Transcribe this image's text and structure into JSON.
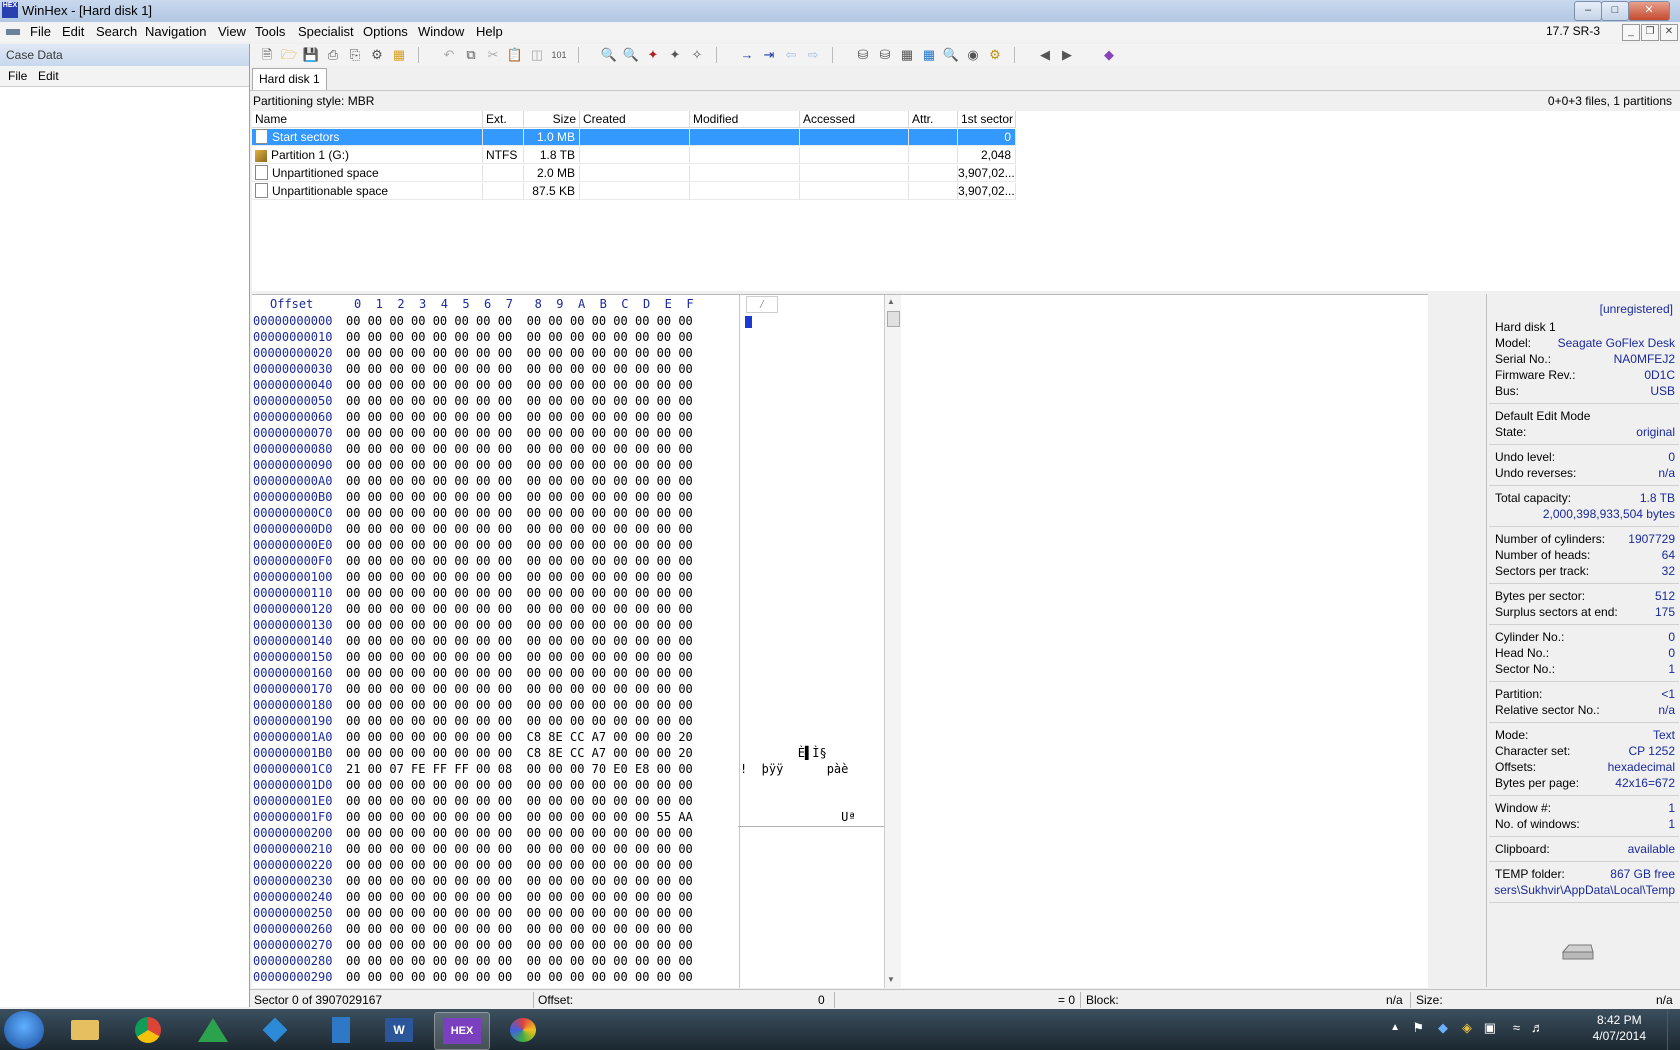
{
  "window": {
    "title": "WinHex - [Hard disk 1]",
    "version": "17.7 SR-3"
  },
  "menu": [
    "File",
    "Edit",
    "Search",
    "Navigation",
    "View",
    "Tools",
    "Specialist",
    "Options",
    "Window",
    "Help"
  ],
  "case": {
    "header": "Case Data",
    "menu": [
      "File",
      "Edit"
    ]
  },
  "tab": "Hard disk 1",
  "dir": {
    "partitioning": "Partitioning style: MBR",
    "summary": "0+0+3 files, 1 partitions",
    "columns": [
      "Name",
      "Ext.",
      "Size",
      "Created",
      "Modified",
      "Accessed",
      "Attr.",
      "1st sector"
    ],
    "rows": [
      {
        "name": "Start sectors",
        "ext": "",
        "size": "1.0 MB",
        "first": "0"
      },
      {
        "name": "Partition 1 (G:)",
        "ext": "NTFS",
        "size": "1.8 TB",
        "first": "2,048"
      },
      {
        "name": "Unpartitioned space",
        "ext": "",
        "size": "2.0 MB",
        "first": "3,907,02..."
      },
      {
        "name": "Unpartitionable space",
        "ext": "",
        "size": "87.5 KB",
        "first": "3,907,02..."
      }
    ]
  },
  "hex": {
    "header_offset": "Offset",
    "header_cols": "0  1  2  3  4  5  6  7   8  9  A  B  C  D  E  F",
    "rows": [
      {
        "o": "00000000000",
        "h": "00 00 00 00 00 00 00 00  00 00 00 00 00 00 00 00",
        "t": ""
      },
      {
        "o": "00000000010",
        "h": "00 00 00 00 00 00 00 00  00 00 00 00 00 00 00 00",
        "t": ""
      },
      {
        "o": "00000000020",
        "h": "00 00 00 00 00 00 00 00  00 00 00 00 00 00 00 00",
        "t": ""
      },
      {
        "o": "00000000030",
        "h": "00 00 00 00 00 00 00 00  00 00 00 00 00 00 00 00",
        "t": ""
      },
      {
        "o": "00000000040",
        "h": "00 00 00 00 00 00 00 00  00 00 00 00 00 00 00 00",
        "t": ""
      },
      {
        "o": "00000000050",
        "h": "00 00 00 00 00 00 00 00  00 00 00 00 00 00 00 00",
        "t": ""
      },
      {
        "o": "00000000060",
        "h": "00 00 00 00 00 00 00 00  00 00 00 00 00 00 00 00",
        "t": ""
      },
      {
        "o": "00000000070",
        "h": "00 00 00 00 00 00 00 00  00 00 00 00 00 00 00 00",
        "t": ""
      },
      {
        "o": "00000000080",
        "h": "00 00 00 00 00 00 00 00  00 00 00 00 00 00 00 00",
        "t": ""
      },
      {
        "o": "00000000090",
        "h": "00 00 00 00 00 00 00 00  00 00 00 00 00 00 00 00",
        "t": ""
      },
      {
        "o": "000000000A0",
        "h": "00 00 00 00 00 00 00 00  00 00 00 00 00 00 00 00",
        "t": ""
      },
      {
        "o": "000000000B0",
        "h": "00 00 00 00 00 00 00 00  00 00 00 00 00 00 00 00",
        "t": ""
      },
      {
        "o": "000000000C0",
        "h": "00 00 00 00 00 00 00 00  00 00 00 00 00 00 00 00",
        "t": ""
      },
      {
        "o": "000000000D0",
        "h": "00 00 00 00 00 00 00 00  00 00 00 00 00 00 00 00",
        "t": ""
      },
      {
        "o": "000000000E0",
        "h": "00 00 00 00 00 00 00 00  00 00 00 00 00 00 00 00",
        "t": ""
      },
      {
        "o": "000000000F0",
        "h": "00 00 00 00 00 00 00 00  00 00 00 00 00 00 00 00",
        "t": ""
      },
      {
        "o": "00000000100",
        "h": "00 00 00 00 00 00 00 00  00 00 00 00 00 00 00 00",
        "t": ""
      },
      {
        "o": "00000000110",
        "h": "00 00 00 00 00 00 00 00  00 00 00 00 00 00 00 00",
        "t": ""
      },
      {
        "o": "00000000120",
        "h": "00 00 00 00 00 00 00 00  00 00 00 00 00 00 00 00",
        "t": ""
      },
      {
        "o": "00000000130",
        "h": "00 00 00 00 00 00 00 00  00 00 00 00 00 00 00 00",
        "t": ""
      },
      {
        "o": "00000000140",
        "h": "00 00 00 00 00 00 00 00  00 00 00 00 00 00 00 00",
        "t": ""
      },
      {
        "o": "00000000150",
        "h": "00 00 00 00 00 00 00 00  00 00 00 00 00 00 00 00",
        "t": ""
      },
      {
        "o": "00000000160",
        "h": "00 00 00 00 00 00 00 00  00 00 00 00 00 00 00 00",
        "t": ""
      },
      {
        "o": "00000000170",
        "h": "00 00 00 00 00 00 00 00  00 00 00 00 00 00 00 00",
        "t": ""
      },
      {
        "o": "00000000180",
        "h": "00 00 00 00 00 00 00 00  00 00 00 00 00 00 00 00",
        "t": ""
      },
      {
        "o": "00000000190",
        "h": "00 00 00 00 00 00 00 00  00 00 00 00 00 00 00 00",
        "t": ""
      },
      {
        "o": "000000001A0",
        "h": "00 00 00 00 00 00 00 00  C8 8E CC A7 00 00 00 20",
        "t": ""
      },
      {
        "o": "000000001B0",
        "h": "00 00 00 00 00 00 00 00  C8 8E CC A7 00 00 00 20",
        "t": "        È▌Ì§"
      },
      {
        "o": "000000001C0",
        "h": "21 00 07 FE FF FF 00 08  00 00 00 70 E0 E8 00 00",
        "t": "!  þÿÿ      pàè"
      },
      {
        "o": "000000001D0",
        "h": "00 00 00 00 00 00 00 00  00 00 00 00 00 00 00 00",
        "t": ""
      },
      {
        "o": "000000001E0",
        "h": "00 00 00 00 00 00 00 00  00 00 00 00 00 00 00 00",
        "t": ""
      },
      {
        "o": "000000001F0",
        "h": "00 00 00 00 00 00 00 00  00 00 00 00 00 00 55 AA",
        "t": "              Uª"
      },
      {
        "o": "00000000200",
        "h": "00 00 00 00 00 00 00 00  00 00 00 00 00 00 00 00",
        "t": ""
      },
      {
        "o": "00000000210",
        "h": "00 00 00 00 00 00 00 00  00 00 00 00 00 00 00 00",
        "t": ""
      },
      {
        "o": "00000000220",
        "h": "00 00 00 00 00 00 00 00  00 00 00 00 00 00 00 00",
        "t": ""
      },
      {
        "o": "00000000230",
        "h": "00 00 00 00 00 00 00 00  00 00 00 00 00 00 00 00",
        "t": ""
      },
      {
        "o": "00000000240",
        "h": "00 00 00 00 00 00 00 00  00 00 00 00 00 00 00 00",
        "t": ""
      },
      {
        "o": "00000000250",
        "h": "00 00 00 00 00 00 00 00  00 00 00 00 00 00 00 00",
        "t": ""
      },
      {
        "o": "00000000260",
        "h": "00 00 00 00 00 00 00 00  00 00 00 00 00 00 00 00",
        "t": ""
      },
      {
        "o": "00000000270",
        "h": "00 00 00 00 00 00 00 00  00 00 00 00 00 00 00 00",
        "t": ""
      },
      {
        "o": "00000000280",
        "h": "00 00 00 00 00 00 00 00  00 00 00 00 00 00 00 00",
        "t": ""
      },
      {
        "o": "00000000290",
        "h": "00 00 00 00 00 00 00 00  00 00 00 00 00 00 00 00",
        "t": ""
      }
    ]
  },
  "info": {
    "registration": "[unregistered]",
    "groups": [
      [
        {
          "k": "Hard disk 1",
          "v": ""
        },
        {
          "k": "Model:",
          "v": "Seagate GoFlex Desk"
        },
        {
          "k": "Serial No.:",
          "v": "NA0MFEJ2"
        },
        {
          "k": "Firmware Rev.:",
          "v": "0D1C"
        },
        {
          "k": "Bus:",
          "v": "USB"
        }
      ],
      [
        {
          "k": "Default Edit Mode",
          "v": ""
        },
        {
          "k": "State:",
          "v": "original"
        }
      ],
      [
        {
          "k": "Undo level:",
          "v": "0"
        },
        {
          "k": "Undo reverses:",
          "v": "n/a"
        }
      ],
      [
        {
          "k": "Total capacity:",
          "v": "1.8 TB"
        },
        {
          "k": "",
          "v": "2,000,398,933,504 bytes"
        }
      ],
      [
        {
          "k": "Number of cylinders:",
          "v": "1907729"
        },
        {
          "k": "Number of heads:",
          "v": "64"
        },
        {
          "k": "Sectors per track:",
          "v": "32"
        }
      ],
      [
        {
          "k": "Bytes per sector:",
          "v": "512"
        },
        {
          "k": "Surplus sectors at end:",
          "v": "175"
        }
      ],
      [
        {
          "k": "Cylinder No.:",
          "v": "0"
        },
        {
          "k": "Head No.:",
          "v": "0"
        },
        {
          "k": "Sector No.:",
          "v": "1"
        }
      ],
      [
        {
          "k": "Partition:",
          "v": "<1"
        },
        {
          "k": "Relative sector No.:",
          "v": "n/a"
        }
      ],
      [
        {
          "k": "Mode:",
          "v": "Text"
        },
        {
          "k": "Character set:",
          "v": "CP 1252"
        },
        {
          "k": "Offsets:",
          "v": "hexadecimal"
        },
        {
          "k": "Bytes per page:",
          "v": "42x16=672"
        }
      ],
      [
        {
          "k": "Window #:",
          "v": "1"
        },
        {
          "k": "No. of windows:",
          "v": "1"
        }
      ],
      [
        {
          "k": "Clipboard:",
          "v": "available"
        }
      ],
      [
        {
          "k": "TEMP folder:",
          "v": "867 GB free"
        },
        {
          "k": "",
          "v": "sers\\Sukhvir\\AppData\\Local\\Temp"
        }
      ]
    ]
  },
  "status": {
    "sector": "Sector 0 of 3907029167",
    "offset_label": "Offset:",
    "offset_value": "0",
    "eq": "= 0",
    "block_label": "Block:",
    "block_value": "n/a",
    "size_label": "Size:",
    "size_value": "n/a"
  },
  "taskbar": {
    "time": "8:42 PM",
    "date": "4/07/2014"
  },
  "colors": {
    "selection": "#3399ff",
    "offset_text": "#1a2a9a",
    "cursor": "#1b3acf"
  }
}
